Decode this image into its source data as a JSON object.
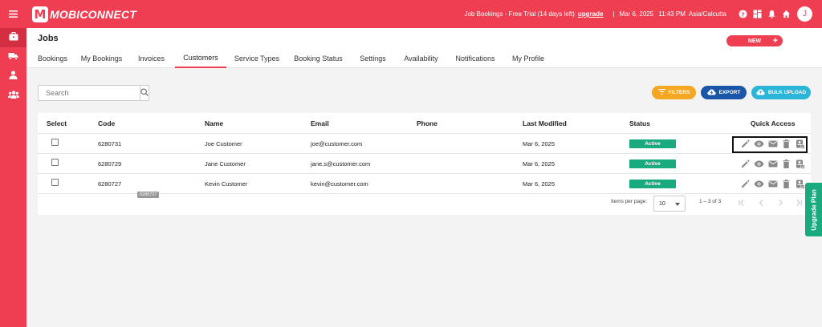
{
  "topbar": {
    "brand": "MOBICONNECT",
    "brand_letter": "M",
    "trial_text": "Job Bookings - Free Trial (14 days left)",
    "upgrade_label": "upgrade",
    "separator": "|",
    "date": "Mar 6, 2025",
    "time": "11:43 PM",
    "timezone": "Asia/Calcutta",
    "avatar_initial": "J",
    "icons": [
      "menu-icon",
      "help-icon",
      "apps-icon",
      "bell-icon",
      "home-icon"
    ]
  },
  "sidebar": {
    "items": [
      {
        "icon": "briefcase-icon",
        "active": true
      },
      {
        "icon": "truck-icon",
        "active": false
      },
      {
        "icon": "user-icon",
        "active": false
      },
      {
        "icon": "group-icon",
        "active": false
      }
    ]
  },
  "header": {
    "title": "Jobs",
    "tabs": [
      {
        "label": "Bookings"
      },
      {
        "label": "My Bookings"
      },
      {
        "label": "Invoices"
      },
      {
        "label": "Customers",
        "active": true
      },
      {
        "label": "Service Types"
      },
      {
        "label": "Booking Status"
      },
      {
        "label": "Settings"
      },
      {
        "label": "Availability"
      },
      {
        "label": "Notifications"
      },
      {
        "label": "My Profile"
      }
    ],
    "new_label": "NEW",
    "new_plus": "+"
  },
  "toolbar": {
    "search_placeholder": "Search",
    "filters_label": "FILTERS",
    "export_label": "EXPORT",
    "bulk_upload_label": "BULK UPLOAD"
  },
  "table": {
    "columns": [
      "Select",
      "Code",
      "Name",
      "Email",
      "Phone",
      "Last Modified",
      "Status",
      "Quick Access"
    ],
    "rows": [
      {
        "code": "6280731",
        "name": "Joe Customer",
        "email": "joe@customer.com",
        "phone": "",
        "last_modified": "Mar 6, 2025",
        "status": "Active"
      },
      {
        "code": "6280729",
        "name": "Jane Customer",
        "email": "jane.s@customer.com",
        "phone": "",
        "last_modified": "Mar 6, 2025",
        "status": "Active"
      },
      {
        "code": "6280727",
        "name": "Kevin Customer",
        "email": "kevin@customer.com",
        "phone": "",
        "last_modified": "Mar 6, 2025",
        "status": "Active"
      }
    ],
    "quick_access_icons": [
      "edit-icon",
      "view-icon",
      "email-icon",
      "delete-icon",
      "contact-card-icon"
    ],
    "tooltip": "6280727",
    "status_color": "#1aaa80"
  },
  "pagination": {
    "items_per_page_label": "Items per page:",
    "items_per_page_value": "10",
    "range_label": "1 – 3 of 3"
  },
  "upgrade_plan_label": "Upgrade Plan",
  "colors": {
    "brand": "#ef3d52",
    "filters": "#f5a623",
    "export": "#1a56a8",
    "bulk_upload": "#2bb5d8",
    "active_status": "#1aaa80"
  }
}
